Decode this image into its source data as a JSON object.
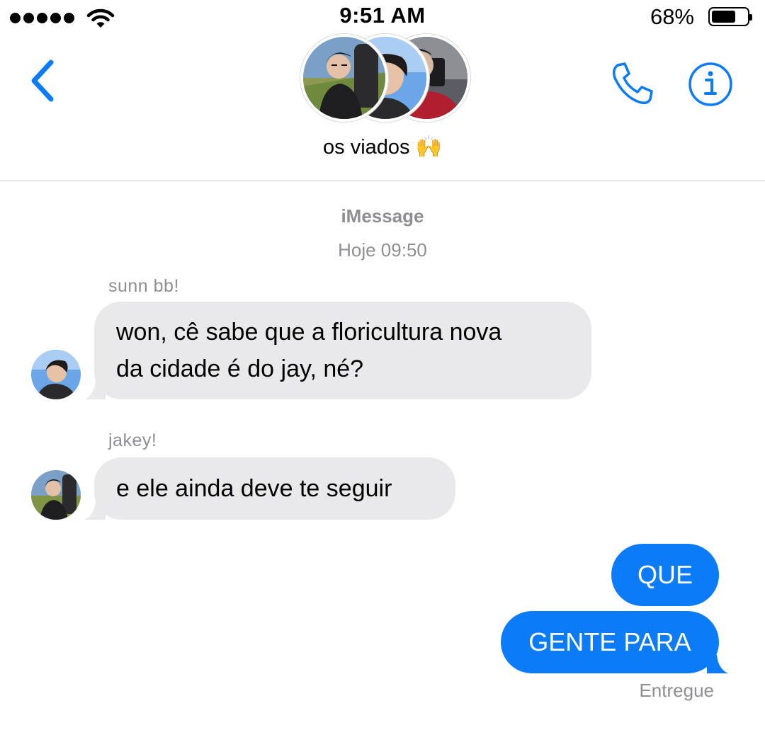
{
  "status_bar": {
    "time": "9:51 AM",
    "battery_percent": "68%",
    "battery_level": 0.68,
    "signal_bars": 5,
    "icons": [
      "signal-dots",
      "wifi-icon",
      "battery-icon"
    ]
  },
  "header": {
    "group_name": "os viados",
    "group_emoji": "🙌",
    "icons": [
      "back-chevron-icon",
      "phone-icon",
      "info-icon"
    ],
    "accent_color": "#0b7bf7"
  },
  "thread": {
    "service": "iMessage",
    "timestamp": "Hoje 09:50",
    "messages": [
      {
        "sender": "sunn bb!",
        "direction": "incoming",
        "text_line1": "won, cê sabe que a floricultura nova",
        "text_line2": "da cidade é do jay, né?"
      },
      {
        "sender": "jakey!",
        "direction": "incoming",
        "text": "e ele ainda deve te seguir"
      },
      {
        "direction": "outgoing",
        "text": "QUE"
      },
      {
        "direction": "outgoing",
        "text": "GENTE PARA"
      }
    ],
    "delivery_status": "Entregue"
  },
  "colors": {
    "incoming_bubble": "#e9e9eb",
    "outgoing_bubble": "#0b7bf7",
    "meta_text": "#8e8e93"
  }
}
